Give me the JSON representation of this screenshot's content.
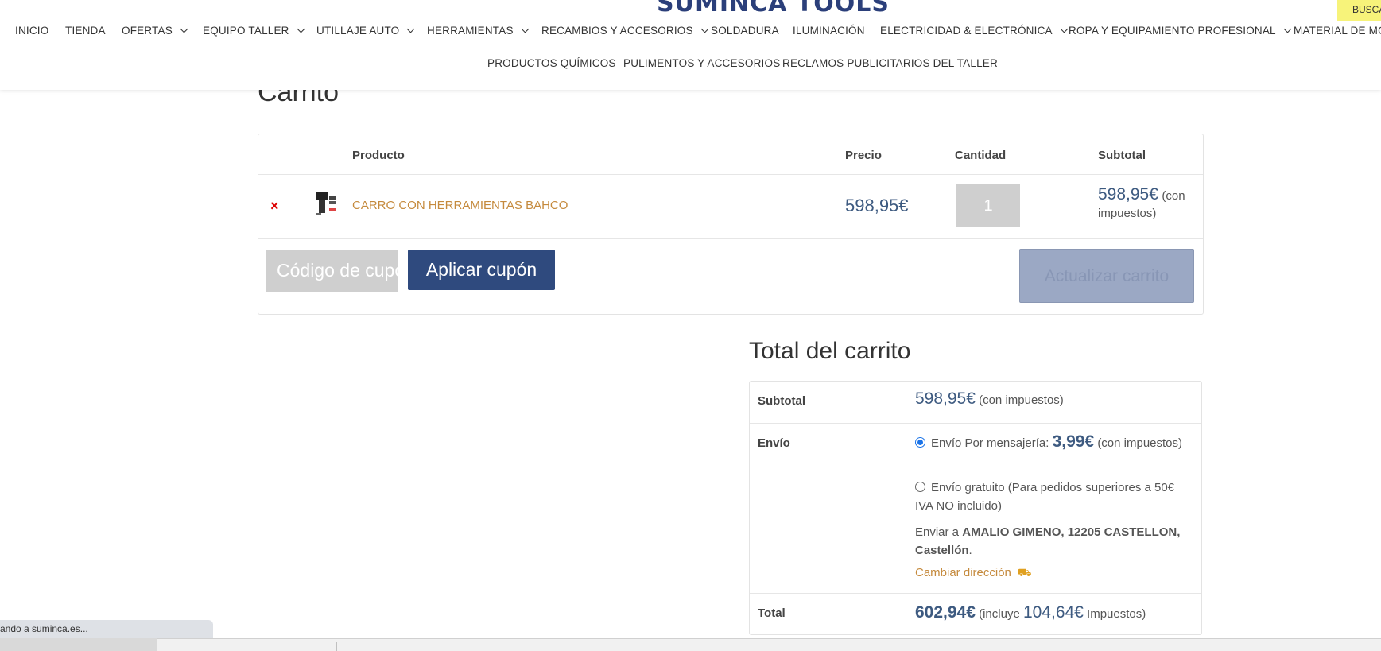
{
  "header": {
    "logo": "SUMINCA TOOLS",
    "search_tab": "BUSCA",
    "nav_row1": [
      {
        "label": "INICIO",
        "dropdown": false
      },
      {
        "label": "TIENDA",
        "dropdown": false
      },
      {
        "label": "OFERTAS",
        "dropdown": true
      },
      {
        "label": "EQUIPO TALLER",
        "dropdown": true
      },
      {
        "label": "UTILLAJE AUTO",
        "dropdown": true
      },
      {
        "label": "HERRAMIENTAS",
        "dropdown": true
      },
      {
        "label": "RECAMBIOS Y ACCESORIOS",
        "dropdown": true
      },
      {
        "label": "SOLDADURA",
        "dropdown": false
      },
      {
        "label": "ILUMINACIÓN",
        "dropdown": false
      },
      {
        "label": "ELECTRICIDAD & ELECTRÓNICA",
        "dropdown": true
      },
      {
        "label": "ROPA Y EQUIPAMIENTO PROFESIONAL",
        "dropdown": true
      },
      {
        "label": "MATERIAL DE MO",
        "dropdown": false
      }
    ],
    "nav_row2": [
      {
        "label": "PRODUCTOS QUÍMICOS"
      },
      {
        "label": "PULIMENTOS Y ACCESORIOS"
      },
      {
        "label": "RECLAMOS PUBLICITARIOS DEL TALLER"
      }
    ]
  },
  "page_title": "Carrito",
  "cart": {
    "headers": {
      "product": "Producto",
      "price": "Precio",
      "quantity": "Cantidad",
      "subtotal": "Subtotal"
    },
    "items": [
      {
        "remove": "×",
        "name": "CARRO CON HERRAMIENTAS BAHCO",
        "price": "598,95€",
        "quantity": "1",
        "subtotal": "598,95€",
        "subtotal_note": "(con impuestos)"
      }
    ],
    "coupon_placeholder": "Código de cupón",
    "apply_coupon": "Aplicar cupón",
    "update_cart": "Actualizar carrito"
  },
  "totals": {
    "title": "Total del carrito",
    "subtotal_label": "Subtotal",
    "subtotal_value": "598,95€",
    "subtotal_note": "(con impuestos)",
    "shipping_label": "Envío",
    "shipping_option1_text": "Envío Por mensajería:",
    "shipping_option1_price": "3,99€",
    "shipping_option1_note": "(con impuestos)",
    "shipping_option2_text": "Envío gratuito (Para pedidos superiores a 50€ IVA NO incluido)",
    "ship_to_prefix": "Enviar a",
    "ship_to_address": "AMALIO GIMENO, 12205 CASTELLON, Castellón",
    "change_address": "Cambiar dirección",
    "total_label": "Total",
    "total_value": "602,94€",
    "total_note_prefix": "(incluye",
    "total_tax": "104,64€",
    "total_note_suffix": "Impuestos)"
  },
  "status_bar": "ando a suminca.es..."
}
